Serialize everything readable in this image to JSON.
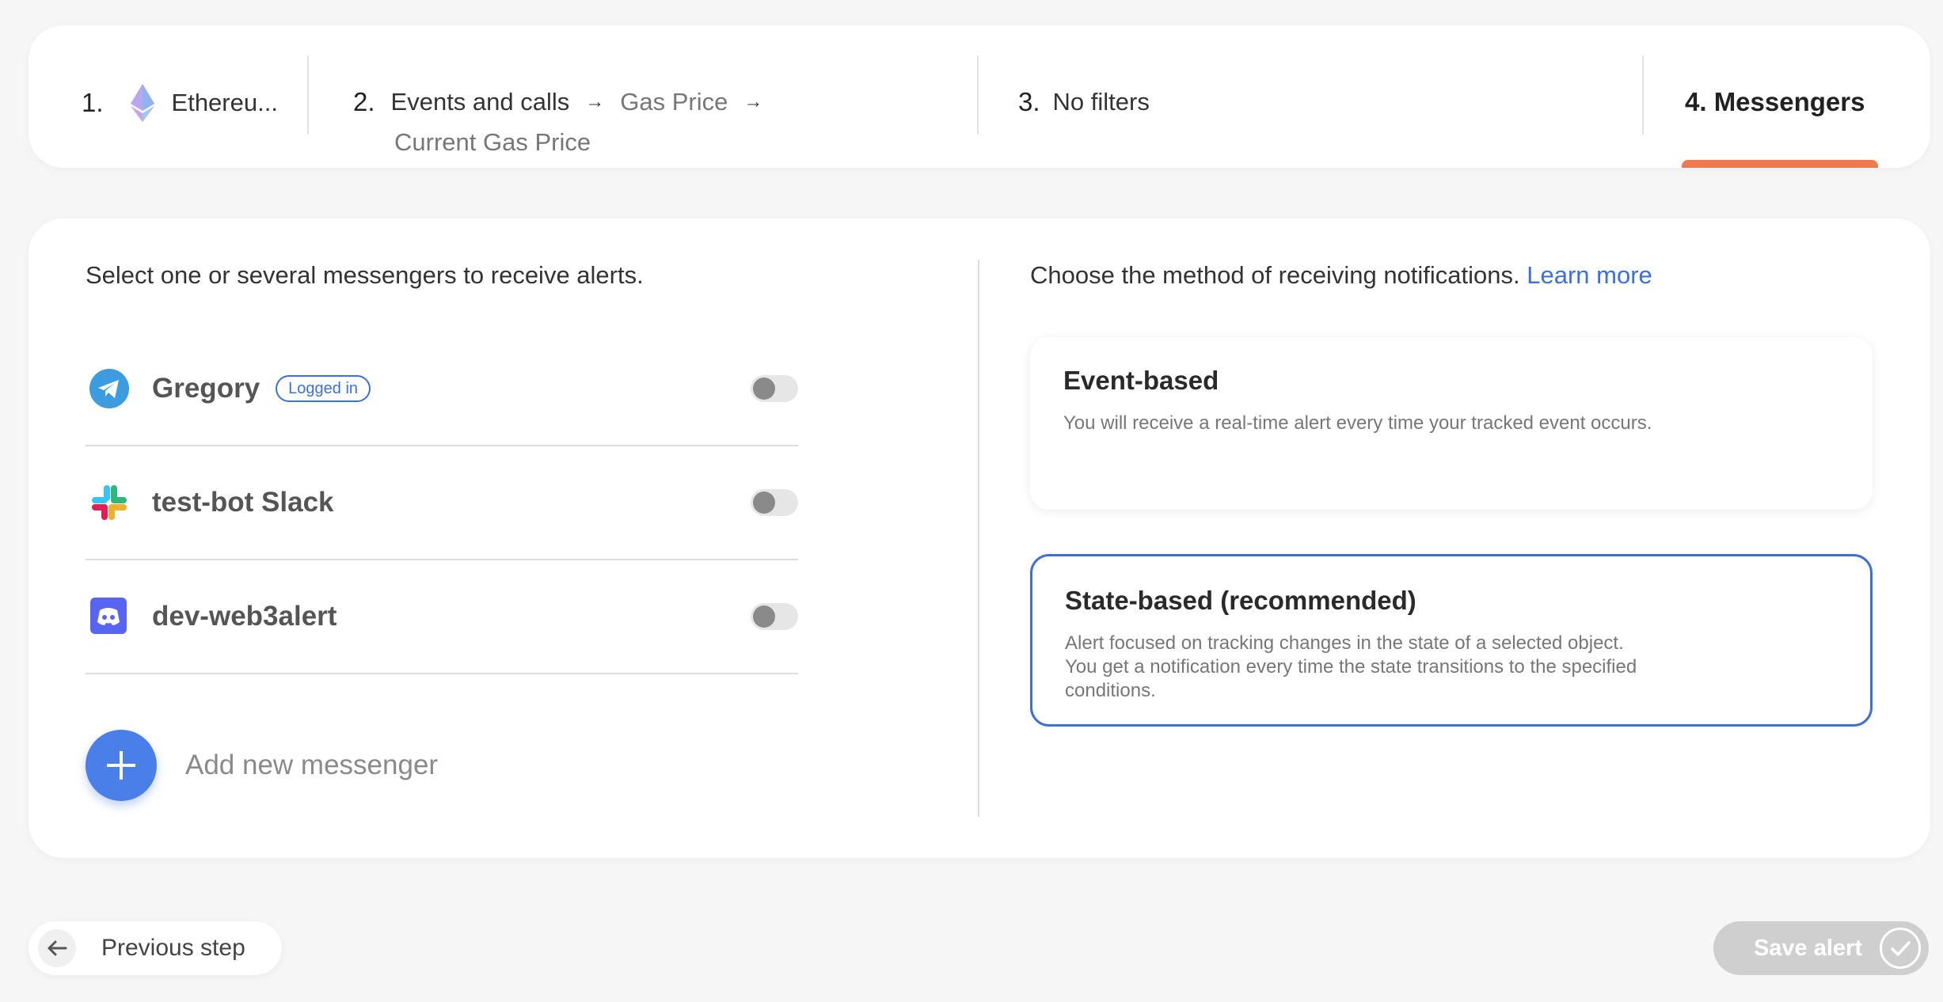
{
  "steps": [
    {
      "num": "1.",
      "label": "Ethereu..."
    },
    {
      "num": "2.",
      "label": "Events and calls",
      "sub1": "Gas Price",
      "sub2": "Current Gas Price"
    },
    {
      "num": "3.",
      "label": "No filters"
    },
    {
      "num": "",
      "label": "4. Messengers"
    }
  ],
  "arrows": {
    "a1": "→",
    "a2": "→"
  },
  "colors": {
    "accent": "#4a7ee8",
    "active_step": "#f07a4f",
    "link": "#3c6fd8",
    "save_disabled": "#cfcfcf"
  },
  "messengers": {
    "title": "Select one or several messengers to receive alerts.",
    "items": [
      {
        "name": "Gregory",
        "badge": "Logged in",
        "icon": "telegram-icon",
        "enabled": false
      },
      {
        "name": "test-bot Slack",
        "icon": "slack-icon",
        "enabled": false
      },
      {
        "name": "dev-web3alert",
        "icon": "discord-icon",
        "enabled": false
      }
    ],
    "add_label": "Add new messenger"
  },
  "methods": {
    "title": "Choose the method of receiving notifications.",
    "learn_more": "Learn more",
    "selected": "State-based (recommended)",
    "options": [
      {
        "title": "Event-based",
        "desc": "You will receive a real-time alert every time your tracked event occurs."
      },
      {
        "title": "State-based (recommended)",
        "desc": "Alert focused on tracking changes in the state of a selected object.\nYou get a notification every time the state transitions to the specified\nconditions."
      }
    ]
  },
  "footer": {
    "prev_label": "Previous step",
    "save_label": "Save alert"
  }
}
